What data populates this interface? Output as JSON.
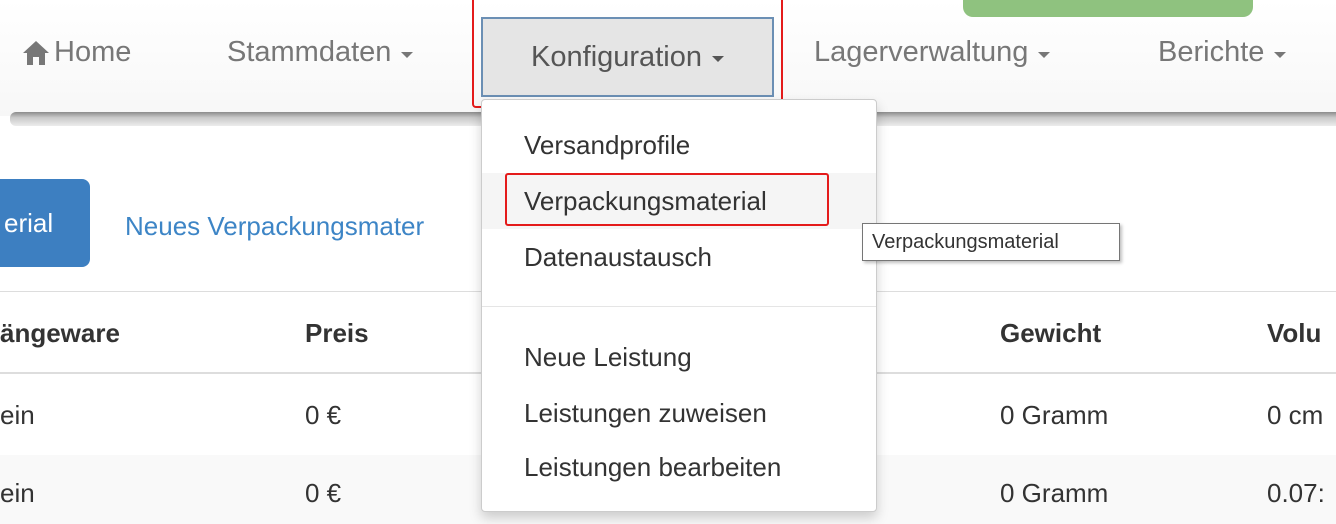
{
  "navbar": {
    "home": "Home",
    "stammdaten": "Stammdaten",
    "konfiguration": "Konfiguration",
    "lagerverwaltung": "Lagerverwaltung",
    "berichte": "Berichte",
    "icons": {
      "home": "home-icon",
      "caret": "caret-down-icon"
    }
  },
  "dropdown": {
    "items": [
      "Versandprofile",
      "Verpackungsmaterial",
      "Datenaustausch"
    ],
    "items2": [
      "Neue Leistung",
      "Leistungen zuweisen",
      "Leistungen bearbeiten"
    ],
    "highlighted": "Verpackungsmaterial"
  },
  "tooltip": "Verpackungsmaterial",
  "page": {
    "primary_button": "erial",
    "new_link": "Neues Verpackungsmater"
  },
  "table": {
    "headers": [
      "ängeware",
      "Preis",
      "Gewicht",
      "Volu"
    ],
    "rows": [
      [
        "ein",
        "0 €",
        "0 Gramm",
        "0 cm"
      ],
      [
        "ein",
        "0 €",
        "0 Gramm",
        "0.07:"
      ]
    ]
  },
  "colors": {
    "highlight_border": "#e41b1b",
    "primary": "#3d7fc1",
    "link": "#3d85c6"
  }
}
